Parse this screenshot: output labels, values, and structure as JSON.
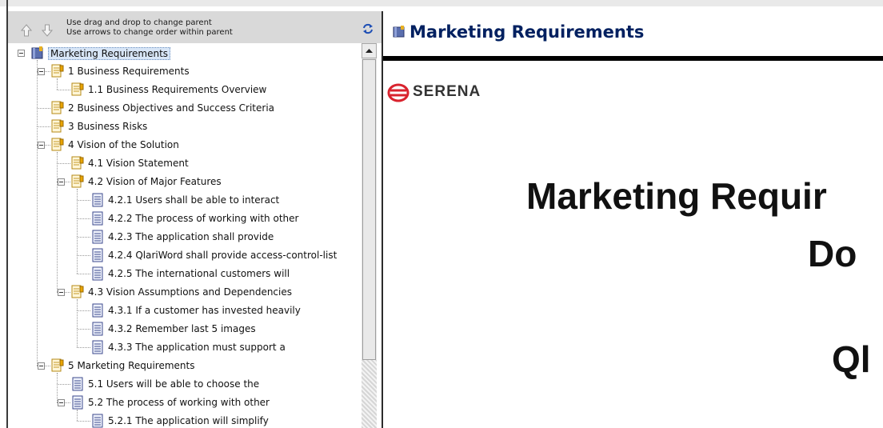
{
  "toolbar": {
    "hint_line1": "Use drag and drop to change parent",
    "hint_line2": "Use arrows to change order within parent"
  },
  "tree": [
    {
      "label": "Marketing Requirements",
      "level": 0,
      "icon": "book-icon",
      "expanded": true,
      "selected": true
    },
    {
      "label": "1 Business Requirements",
      "level": 1,
      "icon": "document-note-icon",
      "expanded": true
    },
    {
      "label": "1.1 Business Requirements Overview",
      "level": 2,
      "icon": "document-note-icon"
    },
    {
      "label": "2 Business Objectives and Success Criteria",
      "level": 1,
      "icon": "document-note-icon"
    },
    {
      "label": "3 Business Risks",
      "level": 1,
      "icon": "document-note-icon"
    },
    {
      "label": "4 Vision of the Solution",
      "level": 1,
      "icon": "document-note-icon",
      "expanded": true
    },
    {
      "label": "4.1 Vision Statement",
      "level": 2,
      "icon": "document-note-icon"
    },
    {
      "label": "4.2 Vision of Major Features",
      "level": 2,
      "icon": "document-note-icon",
      "expanded": true
    },
    {
      "label": "4.2.1 Users shall be able to interact",
      "level": 3,
      "icon": "requirement-icon"
    },
    {
      "label": "4.2.2 The process of working with other",
      "level": 3,
      "icon": "requirement-icon"
    },
    {
      "label": "4.2.3 The application shall provide",
      "level": 3,
      "icon": "requirement-icon"
    },
    {
      "label": "4.2.4 QlariWord shall provide access-control-list",
      "level": 3,
      "icon": "requirement-icon"
    },
    {
      "label": "4.2.5 The international customers will",
      "level": 3,
      "icon": "requirement-icon"
    },
    {
      "label": "4.3 Vision Assumptions and Dependencies",
      "level": 2,
      "icon": "document-note-icon",
      "expanded": true
    },
    {
      "label": "4.3.1 If a customer has invested heavily",
      "level": 3,
      "icon": "requirement-icon"
    },
    {
      "label": "4.3.2 Remember last 5 images",
      "level": 3,
      "icon": "requirement-icon"
    },
    {
      "label": "4.3.3 The application must support a",
      "level": 3,
      "icon": "requirement-icon"
    },
    {
      "label": "5 Marketing Requirements",
      "level": 1,
      "icon": "document-note-icon",
      "expanded": true
    },
    {
      "label": "5.1 Users will be able to choose the",
      "level": 2,
      "icon": "requirement-icon"
    },
    {
      "label": "5.2 The process of working with other",
      "level": 2,
      "icon": "requirement-icon",
      "expanded": true
    },
    {
      "label": "5.2.1 The application will simplify",
      "level": 3,
      "icon": "requirement-icon"
    }
  ],
  "document": {
    "title": "Marketing Requirements",
    "logo_text": "SERENA",
    "heading_line1": "Marketing Requir",
    "heading_line2": "Do",
    "heading_line3": "Ql"
  },
  "colors": {
    "title": "#002060",
    "selection": "#d8e6f7",
    "logo_red": "#d9232e"
  }
}
